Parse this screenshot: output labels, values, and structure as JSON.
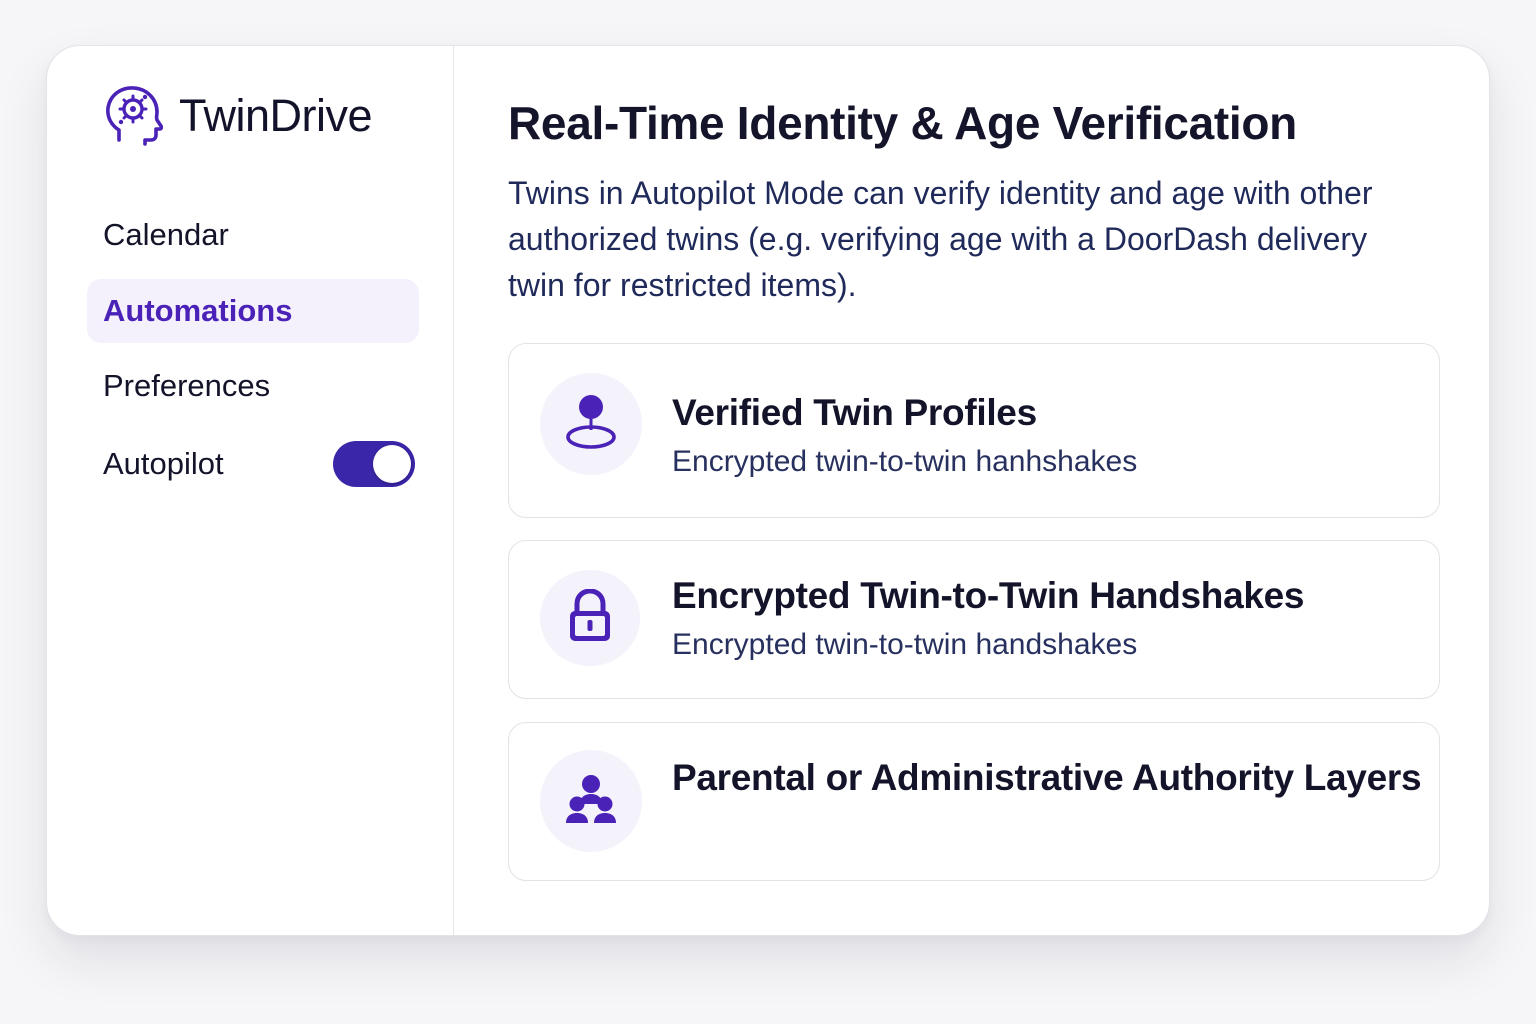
{
  "app": {
    "name": "TwinDrive",
    "logo_icon": "brain-head-icon",
    "accent_color": "#3a26a8",
    "active_color": "#4a22b8"
  },
  "sidebar": {
    "items": [
      {
        "label": "Calendar",
        "active": false
      },
      {
        "label": "Automations",
        "active": true
      },
      {
        "label": "Preferences",
        "active": false
      }
    ],
    "autopilot": {
      "label": "Autopilot",
      "enabled": true
    }
  },
  "main": {
    "title": "Real-Time Identity & Age Verification",
    "description": "Twins in Autopilot Mode can verify identity and age with other authorized twins (e.g. verifying age with a DoorDash delivery twin for restricted items).",
    "cards": [
      {
        "icon": "user-pin-icon",
        "title": "Verified Twin Profiles",
        "subtitle": "Encrypted twin-to-twin hanhshakes"
      },
      {
        "icon": "lock-icon",
        "title": "Encrypted Twin-to-Twin Handshakes",
        "subtitle": "Encrypted twin-to-twin handshakes"
      },
      {
        "icon": "people-group-icon",
        "title": "Parental or Administrative Authority Layers",
        "subtitle": ""
      }
    ]
  }
}
